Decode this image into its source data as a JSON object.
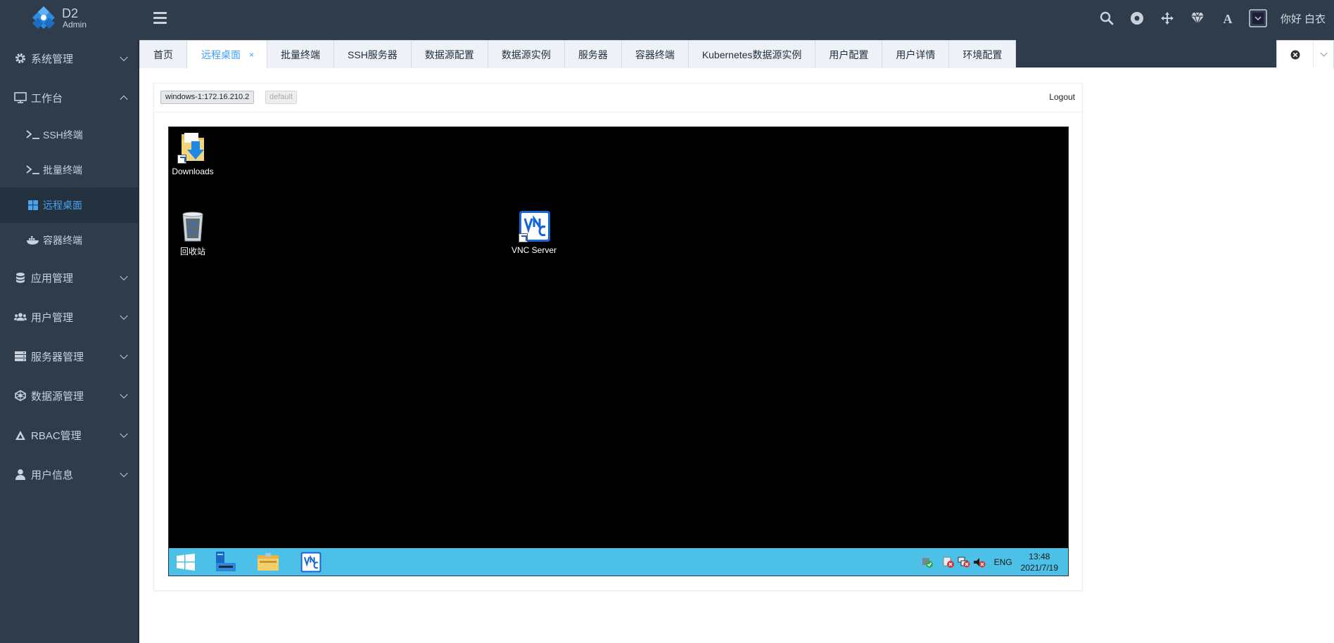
{
  "app": {
    "logo_title": "D2",
    "logo_subtitle": "Admin"
  },
  "header": {
    "icons": [
      "search-icon",
      "record-icon",
      "move-icon",
      "diamond-icon",
      "font-size-icon",
      "theme-icon"
    ],
    "user_greeting": "你好 白衣"
  },
  "sidebar": {
    "menus": [
      {
        "label": "系统管理",
        "icon": "gear-icon"
      },
      {
        "label": "工作台",
        "icon": "monitor-icon"
      },
      {
        "label": "应用管理",
        "icon": "database-icon"
      },
      {
        "label": "用户管理",
        "icon": "users-icon"
      },
      {
        "label": "服务器管理",
        "icon": "server-icon"
      },
      {
        "label": "数据源管理",
        "icon": "network-icon"
      },
      {
        "label": "RBAC管理",
        "icon": "rbac-icon"
      },
      {
        "label": "用户信息",
        "icon": "user-icon"
      }
    ],
    "workbench_items": [
      {
        "label": "SSH终端",
        "icon": "terminal-icon"
      },
      {
        "label": "批量终端",
        "icon": "terminal-icon"
      },
      {
        "label": "远程桌面",
        "icon": "windows-icon"
      },
      {
        "label": "容器终端",
        "icon": "docker-icon"
      }
    ]
  },
  "tabs": [
    {
      "label": "首页"
    },
    {
      "label": "远程桌面",
      "active": true,
      "close": "×"
    },
    {
      "label": "批量终端"
    },
    {
      "label": "SSH服务器"
    },
    {
      "label": "数据源配置"
    },
    {
      "label": "数据源实例"
    },
    {
      "label": "服务器"
    },
    {
      "label": "容器终端"
    },
    {
      "label": "Kubernetes数据源实例"
    },
    {
      "label": "用户配置"
    },
    {
      "label": "用户详情"
    },
    {
      "label": "环境配置"
    }
  ],
  "remote": {
    "connection_tag": "windows-1:172.16.210.2",
    "default_tag": "default",
    "logout_label": "Logout",
    "desktop_icons": {
      "downloads": "Downloads",
      "recycle_bin": "回收站",
      "vnc_server": "VNC Server"
    },
    "taskbar": {
      "language": "ENG",
      "time": "13:48",
      "date": "2021/7/19"
    }
  },
  "colors": {
    "sidebar_bg": "#2e3c4c",
    "active_accent": "#409eff",
    "taskbar_bg": "#4cc0e6",
    "desktop_bg": "#000000"
  }
}
